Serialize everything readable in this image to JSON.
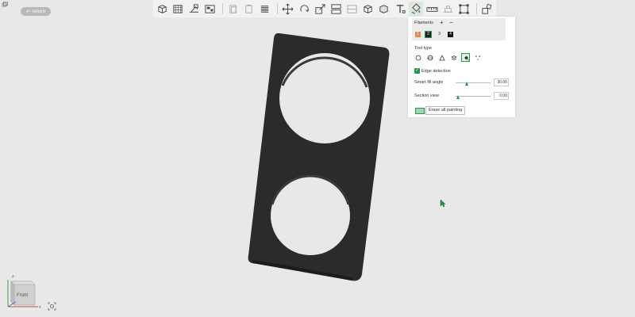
{
  "topbar": {
    "corner_icon": "window-restore-icon",
    "return_label": "return",
    "return_icon": "undo-arrow-icon"
  },
  "toolbar": {
    "buttons": [
      "add-cube-icon",
      "grid-plate-icon",
      "auto-orient-icon",
      "arrange-icon",
      "copy-icon",
      "paste-icon",
      "layers-icon",
      "move-icon",
      "rotate-icon",
      "scale-icon",
      "split-icon",
      "cut-icon",
      "hollow-icon",
      "cube-view-icon",
      "text-icon",
      "paint-icon",
      "measure-icon",
      "emboss-icon",
      "support-icon",
      "assembly-icon"
    ]
  },
  "panel": {
    "filaments_label": "Filaments",
    "add_symbol": "+",
    "remove_symbol": "−",
    "filaments": [
      "1",
      "2",
      "3",
      "4"
    ],
    "filament_colors": [
      "#e9883f",
      "#1f1f1f",
      "#ffffff",
      "#111111"
    ],
    "tool_type_label": "Tool type",
    "tool_types": [
      "circle-brush-icon",
      "sphere-brush-icon",
      "triangle-icon",
      "height-range-icon",
      "fill-bucket-icon",
      "gap-fill-icon"
    ],
    "active_tool": "fill-bucket-icon",
    "edge_detection_label": "Edge detection",
    "edge_detection_checked": true,
    "smart_fill_label": "Smart fill angle",
    "smart_fill_value": "30.00",
    "smart_fill_fraction": 0.33,
    "section_view_label": "Section view",
    "section_view_value": "0.00",
    "section_view_fraction": 0.0,
    "erase_label": "Erase all painting"
  },
  "viewport": {
    "axis_front_label": "Front",
    "axis_z": "Z",
    "axis_x": "X",
    "model_color": "#2e2e2e",
    "accent": "#1f9a4a"
  }
}
